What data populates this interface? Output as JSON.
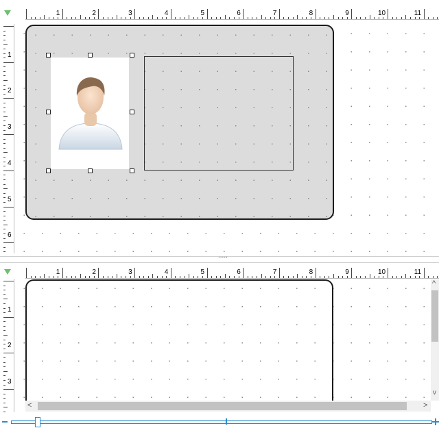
{
  "rulers": {
    "top_numbers": [
      "1",
      "2",
      "3",
      "4",
      "5",
      "6",
      "7",
      "8",
      "9",
      "10",
      "11"
    ],
    "left_numbers_top": [
      "1",
      "2",
      "3",
      "4",
      "5",
      "6"
    ],
    "left_numbers_bottom": [
      "1",
      "2",
      "3"
    ]
  },
  "icons": {
    "corner": "ruler-origin-triangle-icon",
    "avatar": "user-placeholder-icon",
    "scroll_up": "^",
    "scroll_down": "v",
    "scroll_left": "<",
    "scroll_right": ">"
  },
  "divider": {
    "grip": "....."
  },
  "colors": {
    "card_fill": "#dcdcdc",
    "accent": "#2e8bc9",
    "ruler_marker": "#6fbf6f"
  }
}
